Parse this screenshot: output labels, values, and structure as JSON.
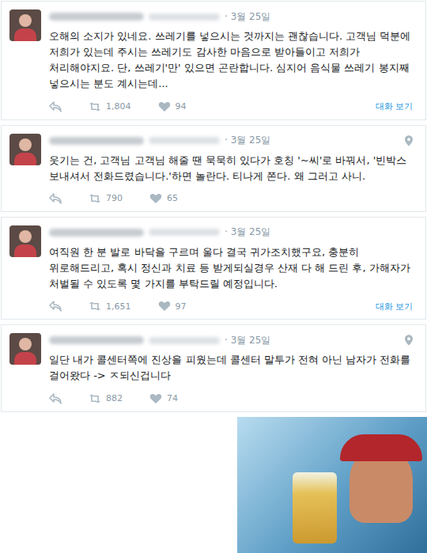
{
  "tweets": [
    {
      "date": "3월 25일",
      "has_location": false,
      "text": "오해의 소지가 있네요. 쓰레기를 넣으시는 것까지는 괜찮습니다. 고객님 덕분에 저희가 있는데 주시는 쓰레기도 감사한 마음으로 받아들이고 저희가 처리해야지요. 단, 쓰레기'만' 있으면 곤란합니다. 심지어 음식물 쓰레기 봉지째 넣으시는 분도 계시는데...",
      "retweets": "1,804",
      "likes": "94",
      "conversation": "대화 보기"
    },
    {
      "date": "3월 25일",
      "has_location": true,
      "text": "웃기는 건, 고객님 고객님 해줄 땐 묵묵히 있다가 호칭 '~씨'로 바꿔서, '빈박스 보내셔서 전화드렸습니다.'하면 놀란다. 티나게 쫀다. 왜 그러고 사니.",
      "retweets": "790",
      "likes": "65",
      "conversation": ""
    },
    {
      "date": "3월 25일",
      "has_location": false,
      "text": "여직원 한 분 발로 바닥을 구르며 울다 결국 귀가조치했구요, 충분히 위로해드리고, 혹시 정신과 치료 등 받게되실경우 산재 다 해 드린 후, 가해자가 처벌될 수 있도록 몇 가지를 부탁드릴 예정입니다.",
      "retweets": "1,651",
      "likes": "97",
      "conversation": "대화 보기"
    },
    {
      "date": "3월 25일",
      "has_location": true,
      "text": "일단 내가 콜센터쪽에 진상을 피웠는데 콜센터 말투가 전혀 아닌 남자가 전화를 걸어왔다 -> ㅈ되신겁니다",
      "retweets": "882",
      "likes": "74",
      "conversation": ""
    }
  ]
}
